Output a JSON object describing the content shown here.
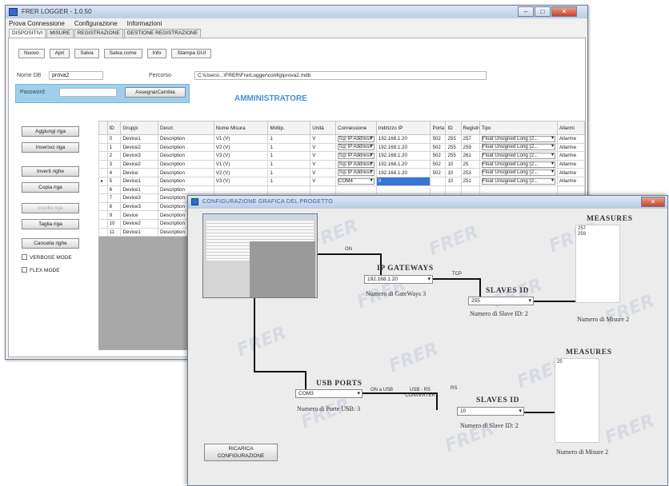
{
  "main_window": {
    "title": "FRER LOGGER - 1.0.50",
    "menu": [
      "Prova Connessione",
      "Configurazione",
      "Informazioni"
    ],
    "tabs": [
      "DISPOSITIVI",
      "MISURE",
      "REGISTRAZIONE",
      "GESTIONE REGISTRAZIONE"
    ],
    "toolbar": [
      "Nuovo",
      "Apri",
      "Salva",
      "Salva come",
      "Info",
      "Stampa GUI"
    ],
    "name_label": "Nome DB",
    "name_value": "prova2",
    "path_label": "Percorso",
    "path_value": "C:\\Users\\...\\FRER\\FrerLogger\\config\\prova2.mdb",
    "password_label": "Password",
    "password_value": "",
    "password_button": "Assegna/Cambia",
    "admin_label": "AMMINISTRATORE",
    "side_buttons": [
      "Aggiungi riga",
      "Inserisci riga",
      "Inverti righe",
      "Copia riga",
      "Incolla riga",
      "Taglia riga",
      "Cancella righe"
    ],
    "verbose_label": "VERBOSE MODE",
    "flex_label": "FLEX MODE",
    "grid_headers": [
      "ID",
      "Gruppi",
      "Descr.",
      "Nome Misura",
      "Moltip.",
      "Unità",
      "Connessione",
      "Indirizzo IP",
      "Porta",
      "ID",
      "Registro",
      "Tipo",
      "Allarmi"
    ],
    "grid_rows": [
      [
        "0",
        "Device1",
        "Description",
        "V1 (V)",
        "1",
        "V",
        "Tcp IP Address",
        "192.168.1.20",
        "502",
        "255",
        "257",
        "Float Unsigned Long (2...",
        "Allarme"
      ],
      [
        "1",
        "Device2",
        "Description",
        "V2 (V)",
        "1",
        "V",
        "Tcp IP Address",
        "192.168.1.20",
        "502",
        "255",
        "259",
        "Float Unsigned Long (2...",
        "Allarme"
      ],
      [
        "2",
        "Device3",
        "Description",
        "V3 (V)",
        "1",
        "V",
        "Tcp IP Address",
        "192.168.1.20",
        "502",
        "255",
        "261",
        "Float Unsigned Long (2...",
        "Allarme"
      ],
      [
        "3",
        "Device2",
        "Description",
        "V1 (V)",
        "1",
        "V",
        "Tcp IP Address",
        "192.168.1.20",
        "502",
        "10",
        "25",
        "Float Unsigned Long (2...",
        "Allarme"
      ],
      [
        "4",
        "Device",
        "Description",
        "V2 (V)",
        "1",
        "V",
        "Tcp IP Address",
        "192.168.1.20",
        "502",
        "10",
        "253",
        "Float Unsigned Long (2...",
        "Allarme"
      ],
      [
        "5",
        "Device1",
        "Description",
        "V3 (V)",
        "1",
        "V",
        "COM4",
        "0",
        "",
        "10",
        "251",
        "Float Unsigned Long (2...",
        "Allarme"
      ],
      [
        "6",
        "Device1",
        "Description",
        "",
        "",
        "",
        "",
        "",
        "",
        "",
        "",
        "",
        ""
      ],
      [
        "7",
        "Device3",
        "Description",
        "",
        "",
        "",
        "",
        "",
        "",
        "",
        "",
        "",
        ""
      ],
      [
        "8",
        "Device3",
        "Description",
        "",
        "",
        "",
        "",
        "",
        "",
        "",
        "",
        "",
        ""
      ],
      [
        "9",
        "Device",
        "Description",
        "",
        "",
        "",
        "",
        "",
        "",
        "",
        "",
        "",
        ""
      ],
      [
        "10",
        "Device2",
        "Description",
        "",
        "",
        "",
        "",
        "",
        "",
        "",
        "",
        "",
        ""
      ],
      [
        "11",
        "Device1",
        "Description",
        "",
        "",
        "",
        "",
        "",
        "",
        "",
        "",
        "",
        ""
      ]
    ]
  },
  "config_window": {
    "title": "CONFIGURAZIONE GRAFICA DEL PROGETTO",
    "ip_header": "IP GATEWAYS",
    "ip_combo": "192.168.1.20",
    "ip_note": "Numero di GateWays 3",
    "slaves_header": "SLAVES ID",
    "slaves_combo": "255",
    "slaves_note": "Numero di Slave ID: 2",
    "measures_header": "MEASURES",
    "measures_items": [
      "257",
      "259"
    ],
    "measures_note": "Numero di Misure 2",
    "usb_header": "USB PORTS",
    "usb_combo": "COM3",
    "usb_note": "Numero di Porte USB: 3",
    "slaves2_header": "SLAVES ID",
    "slaves2_combo": "10",
    "slaves2_note": "Numero di Slave ID: 2",
    "measures2_header": "MEASURES",
    "measures2_items": [
      "25"
    ],
    "measures2_note": "Numero di Misure 2",
    "lbl_on": "ON",
    "lbl_tcp": "TCP",
    "lbl_usb1": "ON a USB",
    "lbl_usb2": "USB - RS CONVERTER",
    "lbl_rs": "RS",
    "load_button": "RICARICA CONFIGURAZIONE",
    "watermark": "FRER"
  }
}
